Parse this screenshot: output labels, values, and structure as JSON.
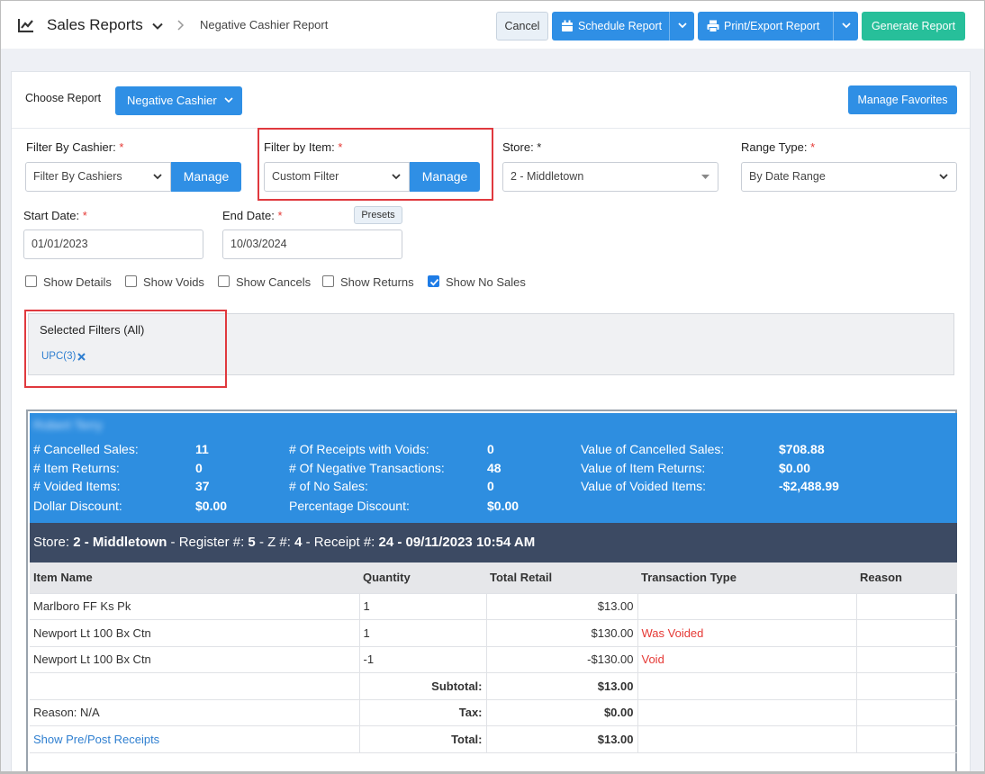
{
  "header": {
    "title": "Sales Reports",
    "breadcrumb": "Negative Cashier Report",
    "cancel_label": "Cancel",
    "schedule_label": "Schedule Report",
    "print_label": "Print/Export Report",
    "generate_label": "Generate Report"
  },
  "form": {
    "choose_report_label": "Choose Report",
    "choose_report_value": "Negative Cashier",
    "manage_favorites_label": "Manage Favorites",
    "cashier_label": "Filter By Cashier:",
    "cashier_value": "Filter By Cashiers",
    "item_label": "Filter by Item:",
    "item_value": "Custom Filter",
    "manage_label": "Manage",
    "store_label": "Store: *",
    "store_value": "2 - Middletown",
    "range_label": "Range Type:",
    "range_value": "By Date Range",
    "start_label": "Start Date:",
    "start_value": "01/01/2023",
    "end_label": "End Date:",
    "end_value": "10/03/2024",
    "presets_label": "Presets",
    "required_mark": "*",
    "checkboxes": [
      {
        "label": "Show Details",
        "checked": false
      },
      {
        "label": "Show Voids",
        "checked": false
      },
      {
        "label": "Show Cancels",
        "checked": false
      },
      {
        "label": "Show Returns",
        "checked": false
      },
      {
        "label": "Show No Sales",
        "checked": true
      }
    ]
  },
  "selected_filters": {
    "heading": "Selected Filters (All)",
    "chips": [
      "UPC(3)"
    ]
  },
  "summary": {
    "cashier_name": "Robert Terry",
    "rows": [
      {
        "label": "# Cancelled Sales:",
        "value": "11"
      },
      {
        "label": "# Item Returns:",
        "value": "0"
      },
      {
        "label": "# Voided Items:",
        "value": "37"
      },
      {
        "label": "Dollar Discount:",
        "value": "$0.00"
      },
      {
        "label": "# Of Receipts with Voids:",
        "value": "0"
      },
      {
        "label": "# Of Negative Transactions:",
        "value": "48"
      },
      {
        "label": "# of No Sales:",
        "value": "0"
      },
      {
        "label": "Percentage Discount:",
        "value": "$0.00"
      },
      {
        "label": "Value of Cancelled Sales:",
        "value": "$708.88"
      },
      {
        "label": "Value of Item Returns:",
        "value": "$0.00"
      },
      {
        "label": "Value of Voided Items:",
        "value": "-$2,488.99"
      }
    ]
  },
  "receipt_header": {
    "store_label": "Store:",
    "store_value": "2 - Middletown",
    "register_label": "- Register #:",
    "register_value": "5",
    "z_label": "- Z #:",
    "z_value": "4",
    "receipt_label": "- Receipt #:",
    "receipt_value": "24 - 09/11/2023 10:54 AM"
  },
  "table": {
    "columns": [
      "Item Name",
      "Quantity",
      "Total Retail",
      "Transaction Type",
      "Reason"
    ],
    "rows": [
      {
        "name": "Marlboro FF Ks Pk",
        "qty": "1",
        "retail": "$13.00",
        "type": "",
        "reason": ""
      },
      {
        "name": "Newport Lt 100 Bx Ctn",
        "qty": "1",
        "retail": "$130.00",
        "type": "Was Voided",
        "reason": ""
      },
      {
        "name": "Newport Lt 100 Bx Ctn",
        "qty": "-1",
        "retail": "-$130.00",
        "type": "Void",
        "reason": ""
      }
    ],
    "subtotal_label": "Subtotal:",
    "subtotal_value": "$13.00",
    "reason_label": "Reason:",
    "reason_value": "N/A",
    "tax_label": "Tax:",
    "tax_value": "$0.00",
    "link_label": "Show Pre/Post Receipts",
    "total_label": "Total:",
    "total_value": "$13.00"
  }
}
